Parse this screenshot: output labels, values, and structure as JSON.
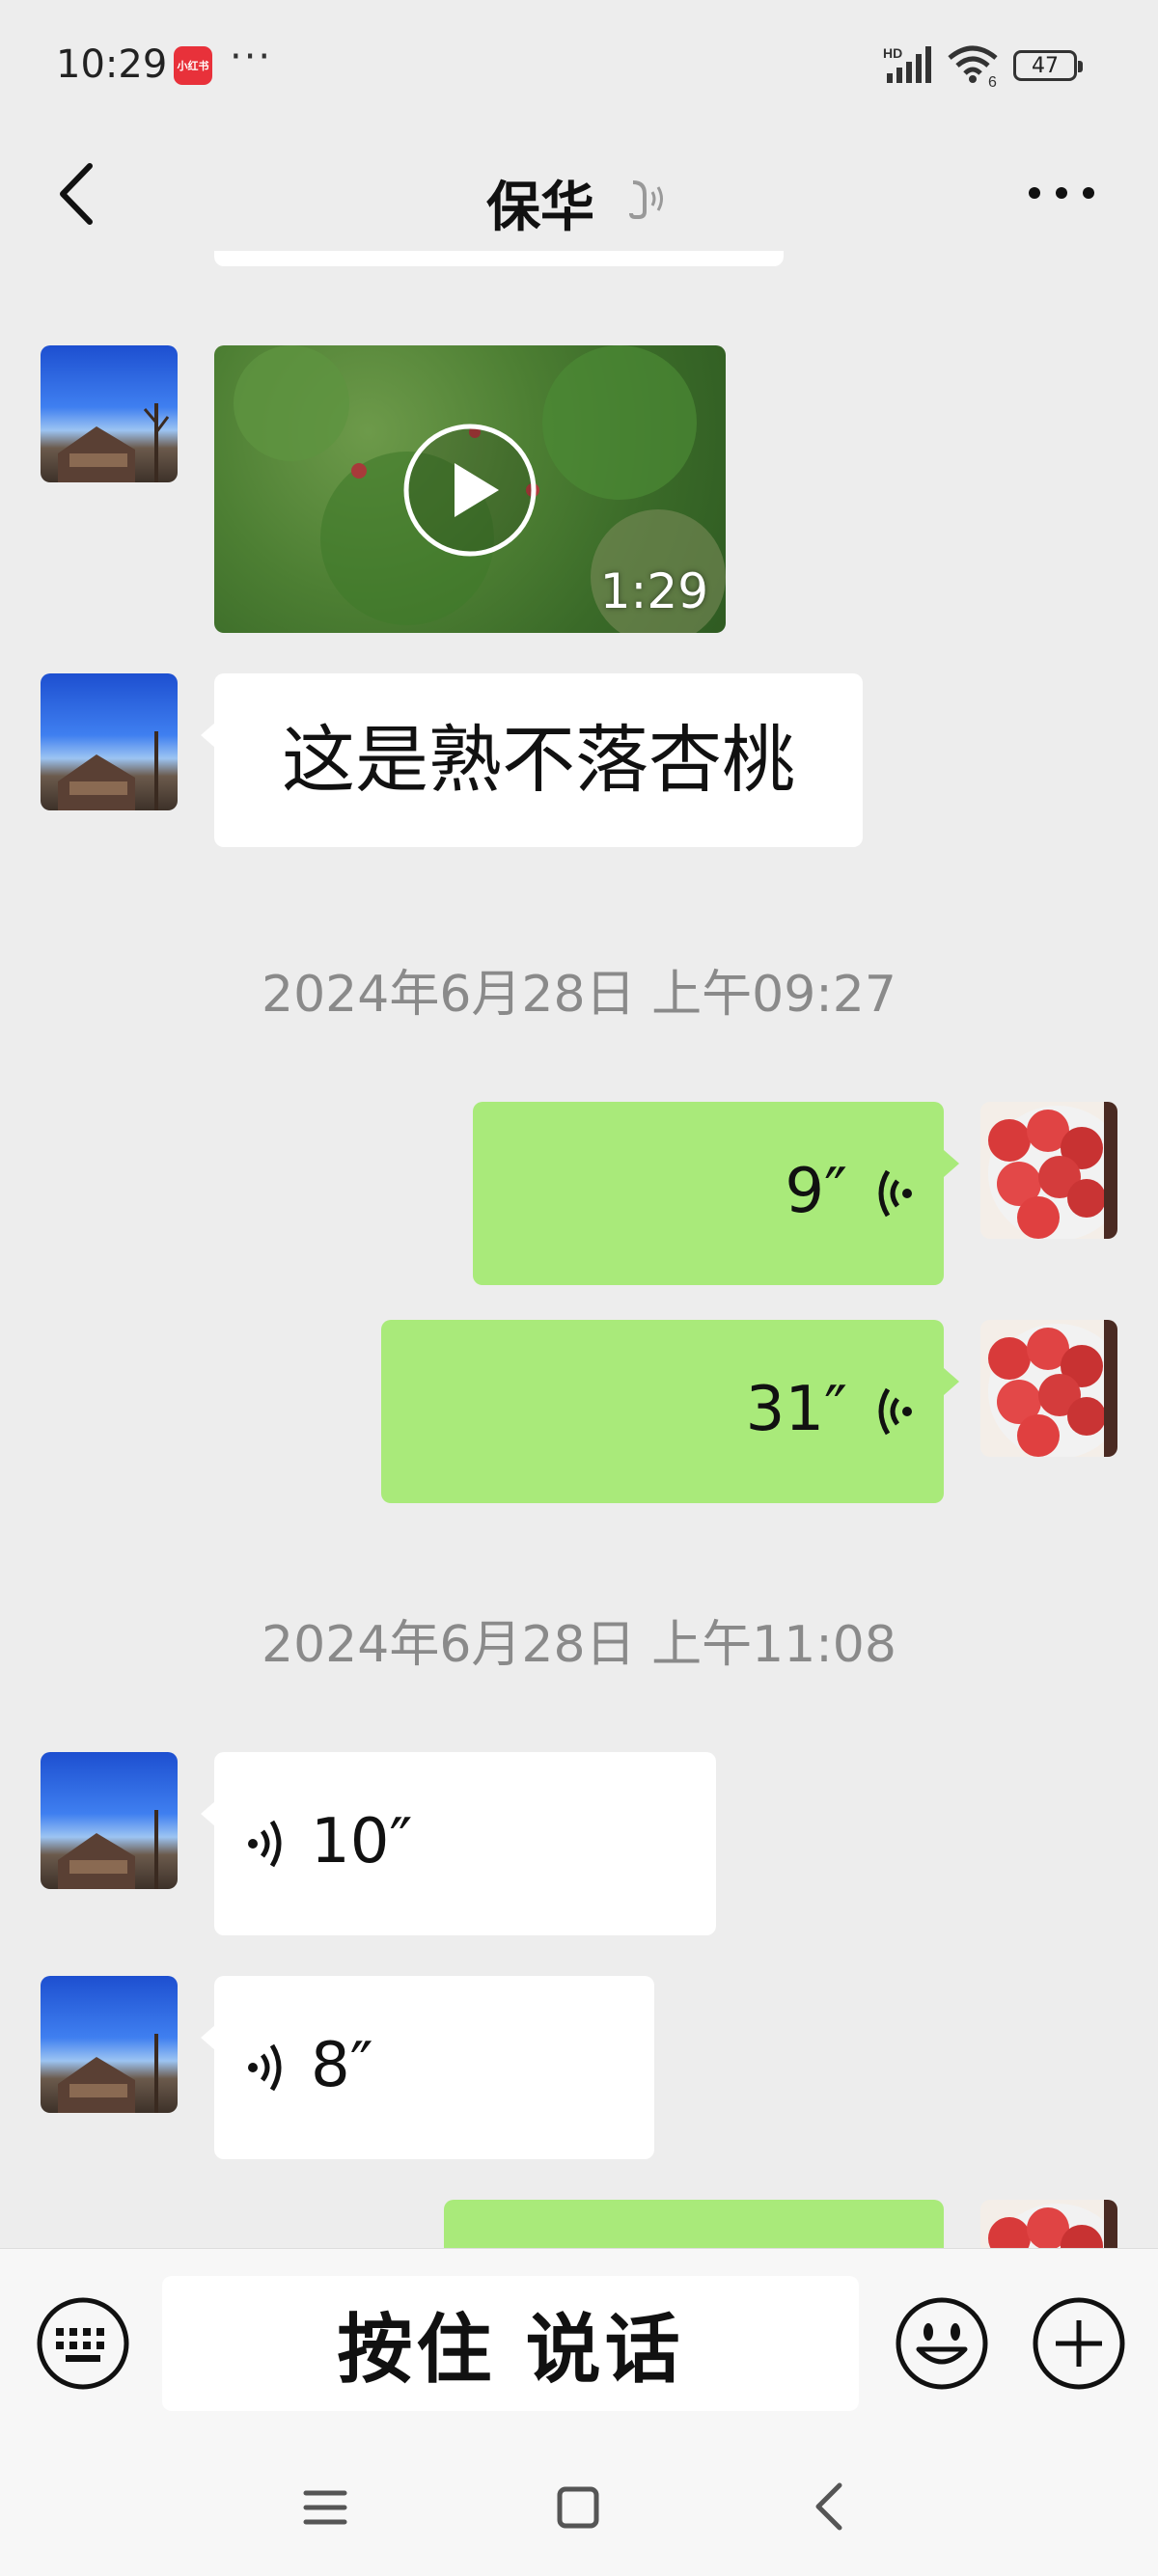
{
  "status_bar": {
    "time": "10:29",
    "app_badge": "小红书",
    "dots": "···",
    "battery": "47",
    "signal_label": "HD",
    "wifi_badge": "6"
  },
  "header": {
    "title": "保华"
  },
  "messages": {
    "video": {
      "duration": "1:29"
    },
    "text1": "这是熟不落杏桃",
    "timestamp1": "2024年6月28日 上午09:27",
    "voice_out1": "9″",
    "voice_out2": "31″",
    "timestamp2": "2024年6月28日 上午11:08",
    "voice_in1": "10″",
    "voice_in2": "8″"
  },
  "input_bar": {
    "hold_to_talk": "按住 说话"
  },
  "colors": {
    "background": "#ededed",
    "outgoing_bubble": "#a9ea7a",
    "incoming_bubble": "#ffffff",
    "timestamp": "#8a8a8a",
    "badge": "#e8313a"
  }
}
